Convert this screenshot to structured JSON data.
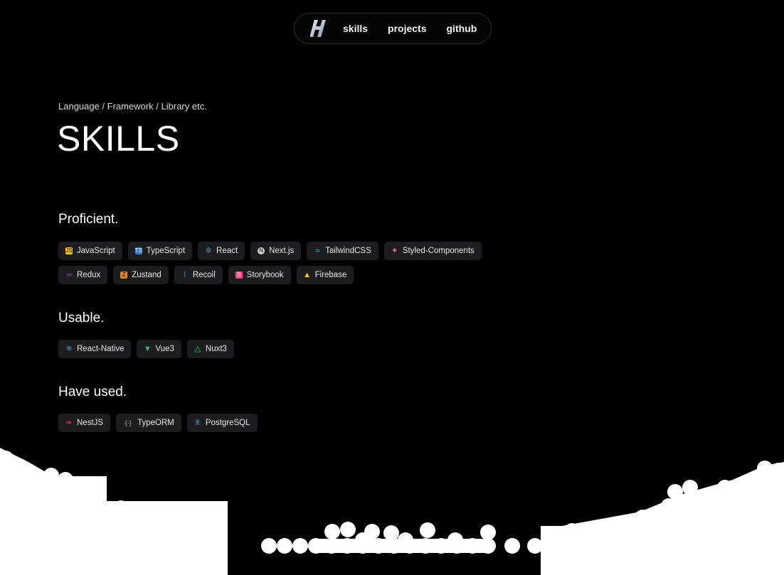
{
  "nav": {
    "logo_letter": "H",
    "links": [
      "skills",
      "projects",
      "github"
    ]
  },
  "hero": {
    "eyebrow": "Language / Framework / Library etc.",
    "title": "SKILLS"
  },
  "sections": {
    "proficient": {
      "title": "Proficient.",
      "rows": [
        [
          {
            "label": "JavaScript",
            "icon": "javascript-icon",
            "color": "#f0c419"
          },
          {
            "label": "TypeScript",
            "icon": "typescript-icon",
            "color": "#3178c6"
          },
          {
            "label": "React",
            "icon": "react-icon",
            "color": "#61dafb"
          },
          {
            "label": "Next.js",
            "icon": "nextjs-icon",
            "color": "#d0d0d0"
          },
          {
            "label": "TailwindCSS",
            "icon": "tailwind-icon",
            "color": "#38bdf8"
          },
          {
            "label": "Styled-Components",
            "icon": "styled-components-icon",
            "color": "#db7093"
          }
        ],
        [
          {
            "label": "Redux",
            "icon": "redux-icon",
            "color": "#764abc"
          },
          {
            "label": "Zustand",
            "icon": "zustand-icon",
            "color": "#e08a1e"
          },
          {
            "label": "Recoil",
            "icon": "recoil-icon",
            "color": "#3578e5"
          },
          {
            "label": "Storybook",
            "icon": "storybook-icon",
            "color": "#ff4785"
          },
          {
            "label": "Firebase",
            "icon": "firebase-icon",
            "color": "#ffca28"
          }
        ]
      ]
    },
    "usable": {
      "title": "Usable.",
      "items": [
        {
          "label": "React-Native",
          "icon": "react-icon",
          "color": "#61dafb"
        },
        {
          "label": "Vue3",
          "icon": "vue-icon",
          "color": "#42b883"
        },
        {
          "label": "Nuxt3",
          "icon": "nuxt-icon",
          "color": "#00dc82"
        }
      ]
    },
    "used": {
      "title": "Have used.",
      "items": [
        {
          "label": "NestJS",
          "icon": "nestjs-icon",
          "color": "#e0234e"
        },
        {
          "label": "TypeORM",
          "icon": "typeorm-icon",
          "color": "#bbbbbb"
        },
        {
          "label": "PostgreSQL",
          "icon": "postgresql-icon",
          "color": "#336791"
        }
      ]
    }
  }
}
